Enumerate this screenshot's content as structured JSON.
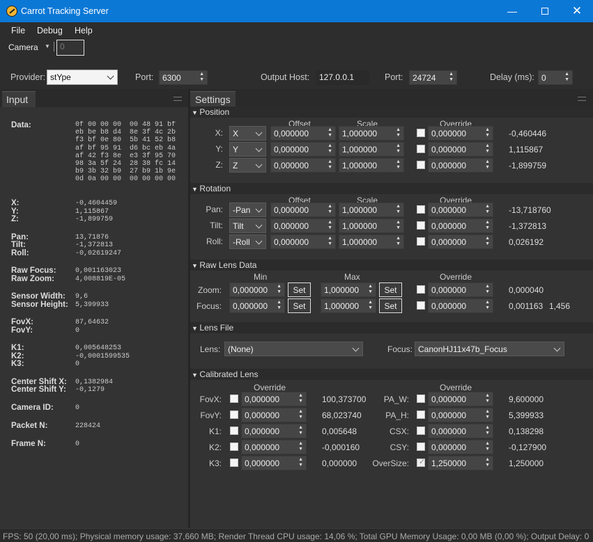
{
  "window": {
    "title": "Carrot Tracking Server"
  },
  "menu": [
    "File",
    "Debug",
    "Help"
  ],
  "camera": {
    "label": "Camera",
    "value": "0"
  },
  "provider": {
    "label": "Provider:",
    "value": "stYpe",
    "port_label": "Port:",
    "port": "6300",
    "out_host_label": "Output Host:",
    "out_host": "127.0.0.1",
    "out_port_label": "Port:",
    "out_port": "24724",
    "delay_label": "Delay (ms):",
    "delay": "0"
  },
  "input": {
    "tab": "Input",
    "data_label": "Data:",
    "hex": [
      "0f 00 00 00  00 48 91 bf",
      "eb be b8 d4  8e 3f 4c 2b",
      "f3 bf 0e 80  5b 41 52 b8",
      "af bf 95 91  d6 bc eb 4a",
      "af 42 f3 8e  e3 3f 95 70",
      "98 3a 5f 24  28 38 fc 14",
      "b9 3b 32 b9  27 b9 1b 9e",
      "0d 0a 00 00  00 00 00 00"
    ],
    "groups": [
      {
        "labels": [
          "X:",
          "Y:",
          "Z:"
        ],
        "values": [
          "-0,4604459",
          "1,115867",
          "-1,899759"
        ]
      },
      {
        "labels": [
          "Pan:",
          "Tilt:",
          "Roll:"
        ],
        "values": [
          "13,71876",
          "-1,372813",
          "-0,02619247"
        ]
      },
      {
        "labels": [
          "Raw Focus:",
          "Raw Zoom:"
        ],
        "values": [
          "0,001163023",
          "4,008819E-05"
        ]
      },
      {
        "labels": [
          "Sensor Width:",
          "Sensor Height:"
        ],
        "values": [
          "9,6",
          "5,399933"
        ]
      },
      {
        "labels": [
          "FovX:",
          "FovY:"
        ],
        "values": [
          "87,64632",
          "0"
        ]
      },
      {
        "labels": [
          "K1:",
          "K2:",
          "K3:"
        ],
        "values": [
          "0,005648253",
          "-0,0001599535",
          "0"
        ]
      },
      {
        "labels": [
          "Center Shift X:",
          "Center Shift Y:"
        ],
        "values": [
          "0,1382984",
          "-0,1279"
        ]
      },
      {
        "labels": [
          "Camera ID:"
        ],
        "values": [
          "0"
        ]
      },
      {
        "labels": [
          "Packet N:"
        ],
        "values": [
          "228424"
        ]
      },
      {
        "labels": [
          "Frame N:"
        ],
        "values": [
          "0"
        ]
      }
    ]
  },
  "settings": {
    "tab": "Settings",
    "position": {
      "title": "Position",
      "offset": "Offset",
      "scale": "Scale",
      "override": "Override",
      "rows": [
        {
          "label": "X:",
          "combo": "X",
          "offset": "0,000000",
          "scale": "1,000000",
          "override": "0,000000",
          "result": "-0,460446"
        },
        {
          "label": "Y:",
          "combo": "Y",
          "offset": "0,000000",
          "scale": "1,000000",
          "override": "0,000000",
          "result": "1,115867"
        },
        {
          "label": "Z:",
          "combo": "Z",
          "offset": "0,000000",
          "scale": "1,000000",
          "override": "0,000000",
          "result": "-1,899759"
        }
      ]
    },
    "rotation": {
      "title": "Rotation",
      "offset": "Offset",
      "scale": "Scale",
      "override": "Override",
      "rows": [
        {
          "label": "Pan:",
          "combo": "-Pan",
          "offset": "0,000000",
          "scale": "1,000000",
          "override": "0,000000",
          "result": "-13,718760"
        },
        {
          "label": "Tilt:",
          "combo": "Tilt",
          "offset": "0,000000",
          "scale": "1,000000",
          "override": "0,000000",
          "result": "-1,372813"
        },
        {
          "label": "Roll:",
          "combo": "-Roll",
          "offset": "0,000000",
          "scale": "1,000000",
          "override": "0,000000",
          "result": "0,026192"
        }
      ]
    },
    "rawlens": {
      "title": "Raw Lens Data",
      "min": "Min",
      "max": "Max",
      "override": "Override",
      "set": "Set",
      "rows": [
        {
          "label": "Zoom:",
          "min": "0,000000",
          "max": "1,000000",
          "override": "0,000000",
          "result": "0,000040",
          "extra": ""
        },
        {
          "label": "Focus:",
          "min": "0,000000",
          "max": "1,000000",
          "override": "0,000000",
          "result": "0,001163",
          "extra": "1,456"
        }
      ]
    },
    "lensfile": {
      "title": "Lens File",
      "lens_label": "Lens:",
      "lens": "(None)",
      "focus_label": "Focus:",
      "focus": "CanonHJ11x47b_Focus"
    },
    "calibrated": {
      "title": "Calibrated Lens",
      "override": "Override",
      "left": [
        {
          "label": "FovX:",
          "value": "0,000000",
          "result": "100,373700"
        },
        {
          "label": "FovY:",
          "value": "0,000000",
          "result": "68,023740"
        },
        {
          "label": "K1:",
          "value": "0,000000",
          "result": "0,005648"
        },
        {
          "label": "K2:",
          "value": "0,000000",
          "result": "-0,000160"
        },
        {
          "label": "K3:",
          "value": "0,000000",
          "result": "0,000000"
        }
      ],
      "right": [
        {
          "label": "PA_W:",
          "value": "0,000000",
          "result": "9,600000",
          "checked": false
        },
        {
          "label": "PA_H:",
          "value": "0,000000",
          "result": "5,399933",
          "checked": false
        },
        {
          "label": "CSX:",
          "value": "0,000000",
          "result": "0,138298",
          "checked": false
        },
        {
          "label": "CSY:",
          "value": "0,000000",
          "result": "-0,127900",
          "checked": false
        },
        {
          "label": "OverSize:",
          "value": "1,250000",
          "result": "1,250000",
          "checked": true
        }
      ]
    }
  },
  "status": "FPS: 50 (20,00 ms); Physical memory usage: 37,660 MB; Render Thread CPU usage: 14,06 %; Total GPU Memory Usage: 0,00 MB (0,00 %); Output Delay: 0"
}
